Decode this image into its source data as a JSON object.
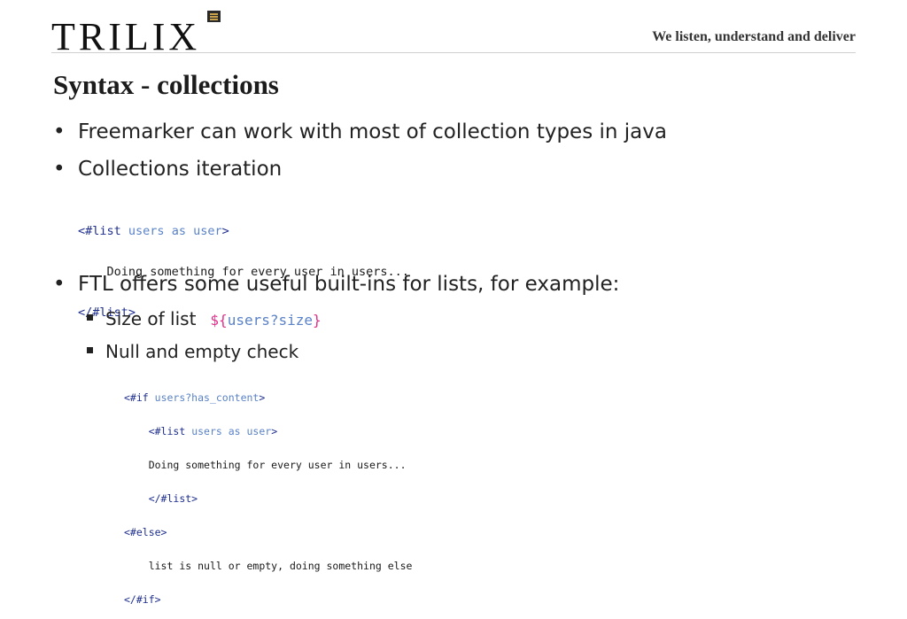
{
  "header": {
    "logo_text": "TRILIX",
    "tagline": "We listen, understand and deliver"
  },
  "slide": {
    "title": "Syntax - collections",
    "bullets": [
      "Freemarker can work with most of collection types in java",
      "Collections iteration",
      "FTL offers some useful built-ins for lists, for example:"
    ],
    "sub_bullets": [
      "Size of list",
      "Null and empty check"
    ]
  },
  "code_list": {
    "open_tag": "<#list",
    "open_vars": "users as user",
    "open_close": ">",
    "body": "Doing something for every user in users...",
    "close_tag": "</#list>"
  },
  "code_size": {
    "open": "${",
    "expr": "users?size",
    "close": "}"
  },
  "code_if": {
    "if_tag": "<#if",
    "if_cond": "users?has_content",
    "if_close": ">",
    "list_tag": "<#list",
    "list_vars": "users as user",
    "list_close": ">",
    "body": "Doing something for every user in users...",
    "list_end": "</#list>",
    "else_tag": "<#else>",
    "else_body": "list is null or empty, doing something else",
    "if_end": "</#if>"
  },
  "colors": {
    "tag": "#1f2f8f",
    "keyword": "#5a82c8",
    "dollar": "#e0308a"
  }
}
